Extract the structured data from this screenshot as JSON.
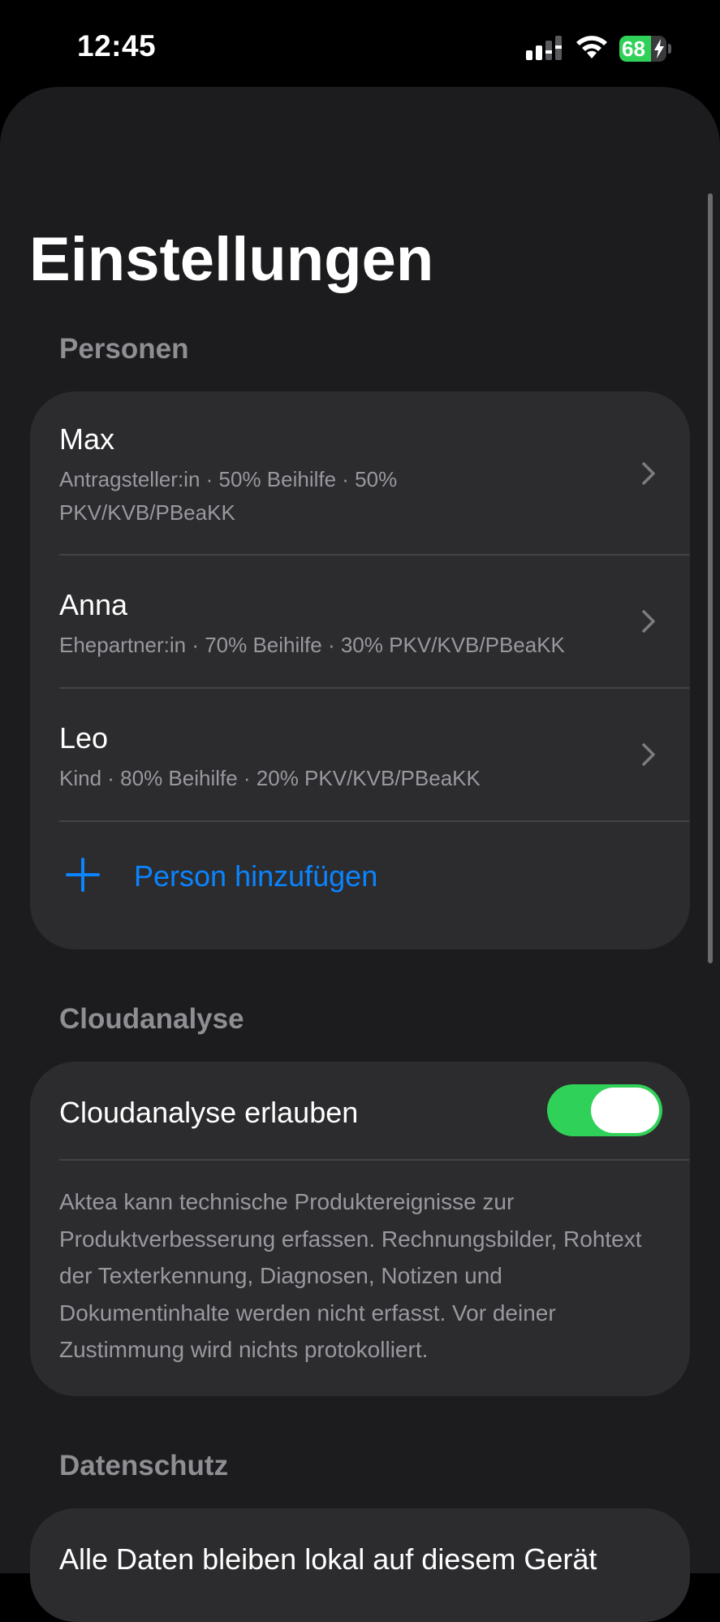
{
  "status_bar": {
    "time": "12:45",
    "battery_level": "68",
    "battery_fraction": 0.68,
    "battery_color": "#30d158"
  },
  "page": {
    "title": "Einstellungen"
  },
  "sections": {
    "persons": {
      "header": "Personen",
      "items": [
        {
          "name": "Max",
          "detail": "Antragsteller:in · 50% Beihilfe · 50% PKV/KVB/PBeaKK"
        },
        {
          "name": "Anna",
          "detail": "Ehepartner:in · 70% Beihilfe · 30% PKV/KVB/PBeaKK"
        },
        {
          "name": "Leo",
          "detail": "Kind · 80% Beihilfe · 20% PKV/KVB/PBeaKK"
        }
      ],
      "add_label": "Person hinzufügen",
      "accent_color": "#0a84ff"
    },
    "cloud": {
      "header": "Cloudanalyse",
      "toggle_label": "Cloudanalyse erlauben",
      "toggle_on": true,
      "toggle_color": "#30d158",
      "description": "Aktea kann technische Produktereignisse zur Produktverbesserung erfassen. Rechnungsbilder, Rohtext der Texterkennung, Diagnosen, Notizen und Dokumentinhalte werden nicht erfasst. Vor deiner Zustimmung wird nichts protokolliert."
    },
    "privacy": {
      "header": "Datenschutz",
      "first_item": "Alle Daten bleiben lokal auf diesem Gerät"
    }
  }
}
